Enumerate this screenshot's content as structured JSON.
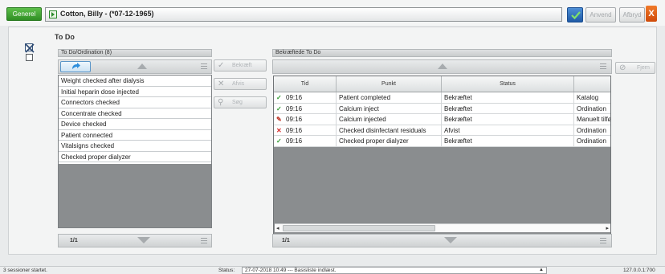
{
  "topbar": {
    "generel_label": "Generel",
    "patient_name": "Cotton, Billy - (*07-12-1965)",
    "anvend_label": "Anvend",
    "afbryd_label": "Afbryd",
    "close_label": "X",
    "accent_green": "#3aa52e",
    "accent_blue": "#2b6cb8",
    "accent_orange": "#e2611a"
  },
  "main": {
    "title": "To Do"
  },
  "left_panel": {
    "title": "To Do/Ordination (8)",
    "items": [
      "Weight checked after dialysis",
      "Initial heparin dose injected",
      "Connectors checked",
      "Concentrate checked",
      "Device checked",
      "Patient connected",
      "Vitalsigns checked",
      "Checked proper dialyzer"
    ],
    "pager": "1/1"
  },
  "middle_buttons": {
    "bekraeft": "Bekræft",
    "afvis": "Afvis",
    "soeg": "Søg"
  },
  "right_panel": {
    "title": "Bekræftede To Do",
    "side_button": "Fjern",
    "columns": [
      "Tid",
      "Punkt",
      "Status",
      ""
    ],
    "rows": [
      {
        "icon": "check-icon",
        "tid": "09:16",
        "punkt": "Patient completed",
        "status": "Bekræftet",
        "extra": "Katalog"
      },
      {
        "icon": "check-icon",
        "tid": "09:16",
        "punkt": "Calcium inject",
        "status": "Bekræftet",
        "extra": "Ordination"
      },
      {
        "icon": "pencil-icon",
        "tid": "09:16",
        "punkt": "Calcium injected",
        "status": "Bekræftet",
        "extra": "Manuelt tilfø"
      },
      {
        "icon": "cross-icon",
        "tid": "09:16",
        "punkt": "Checked disinfectant residuals",
        "status": "Afvist",
        "extra": "Ordination"
      },
      {
        "icon": "check-icon",
        "tid": "09:16",
        "punkt": "Checked proper dialyzer",
        "status": "Bekræftet",
        "extra": "Ordination"
      }
    ],
    "pager": "1/1"
  },
  "statusbar": {
    "sessions": "3 sessioner startet.",
    "status_label": "Status:",
    "status_value": "27-07-2018 10:49 --- Basisliste indlæst.",
    "ip": "127.0.0.1:700"
  }
}
